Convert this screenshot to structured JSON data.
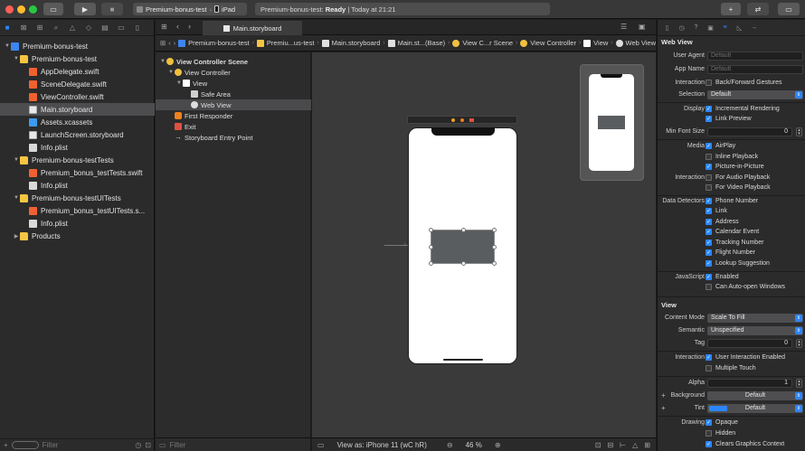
{
  "toolbar": {
    "run_icon": "play-icon",
    "stop_icon": "stop-icon",
    "scheme_name": "Premium-bonus-test",
    "device": "iPad",
    "status_project": "Premium-bonus-test:",
    "status_state": "Ready",
    "status_time": "| Today at 21:21"
  },
  "editor_tab": {
    "label": "Main.storyboard"
  },
  "navigator": {
    "items": [
      {
        "label": "Premium-bonus-test",
        "icon": "project",
        "level": 0,
        "disclosure": "down"
      },
      {
        "label": "Premium-bonus-test",
        "icon": "folder",
        "level": 1,
        "disclosure": "down"
      },
      {
        "label": "AppDelegate.swift",
        "icon": "swift",
        "level": 2
      },
      {
        "label": "SceneDelegate.swift",
        "icon": "swift",
        "level": 2
      },
      {
        "label": "ViewController.swift",
        "icon": "swift",
        "level": 2
      },
      {
        "label": "Main.storyboard",
        "icon": "storyboard",
        "level": 2,
        "selected": true
      },
      {
        "label": "Assets.xcassets",
        "icon": "assets",
        "level": 2
      },
      {
        "label": "LaunchScreen.storyboard",
        "icon": "storyboard",
        "level": 2
      },
      {
        "label": "Info.plist",
        "icon": "plist",
        "level": 2
      },
      {
        "label": "Premium-bonus-testTests",
        "icon": "folder",
        "level": 1,
        "disclosure": "down"
      },
      {
        "label": "Premium_bonus_testTests.swift",
        "icon": "swift",
        "level": 2
      },
      {
        "label": "Info.plist",
        "icon": "plist",
        "level": 2
      },
      {
        "label": "Premium-bonus-testUITests",
        "icon": "folder",
        "level": 1,
        "disclosure": "down"
      },
      {
        "label": "Premium_bonus_testUITests.s...",
        "icon": "swift",
        "level": 2
      },
      {
        "label": "Info.plist",
        "icon": "plist",
        "level": 2
      },
      {
        "label": "Products",
        "icon": "folder",
        "level": 1,
        "disclosure": "right"
      }
    ],
    "filter_placeholder": "Filter"
  },
  "jumpbar": {
    "crumbs": [
      "Premium-bonus-test",
      "Premiu...us-test",
      "Main.storyboard",
      "Main.st...(Base)",
      "View C...r Scene",
      "View Controller",
      "View",
      "Web View"
    ]
  },
  "outline": {
    "items": [
      {
        "label": "View Controller Scene",
        "level": 0,
        "disclosure": "down",
        "bold": true
      },
      {
        "label": "View Controller",
        "level": 1,
        "disclosure": "down"
      },
      {
        "label": "View",
        "level": 2,
        "disclosure": "down"
      },
      {
        "label": "Safe Area",
        "level": 3
      },
      {
        "label": "Web View",
        "level": 3,
        "selected": true
      },
      {
        "label": "First Responder",
        "level": 1
      },
      {
        "label": "Exit",
        "level": 1
      },
      {
        "label": "Storyboard Entry Point",
        "level": 1
      }
    ],
    "filter_placeholder": "Filter"
  },
  "editor_bottom": {
    "view_as": "View as: iPhone 11 (wC hR)",
    "zoom": "46 %"
  },
  "inspector": {
    "web_view_title": "Web View",
    "user_agent_label": "User Agent",
    "user_agent_placeholder": "Default",
    "app_name_label": "App Name",
    "app_name_placeholder": "Default",
    "interaction_label": "Interaction",
    "back_forward": "Back/Forward Gestures",
    "selection_label": "Selection",
    "selection_value": "Default",
    "display_label": "Display",
    "incremental": "Incremental Rendering",
    "link_preview": "Link Preview",
    "min_font_label": "Min Font Size",
    "min_font_value": "0",
    "media_label": "Media",
    "airplay": "AirPlay",
    "inline_playback": "Inline Playback",
    "pip": "Picture-in-Picture",
    "interaction2_label": "Interaction",
    "audio_playback": "For Audio Playback",
    "video_playback": "For Video Playback",
    "data_detectors_label": "Data Detectors",
    "phone": "Phone Number",
    "link": "Link",
    "address": "Address",
    "calendar": "Calendar Event",
    "tracking": "Tracking Number",
    "flight": "Flight Number",
    "lookup": "Lookup Suggestion",
    "javascript_label": "JavaScript",
    "js_enabled": "Enabled",
    "auto_open": "Can Auto-open Windows",
    "view_title": "View",
    "content_mode_label": "Content Mode",
    "content_mode_value": "Scale To Fill",
    "semantic_label": "Semantic",
    "semantic_value": "Unspecified",
    "tag_label": "Tag",
    "tag_value": "0",
    "interaction3_label": "Interaction",
    "user_interaction": "User Interaction Enabled",
    "multiple_touch": "Multiple Touch",
    "alpha_label": "Alpha",
    "alpha_value": "1",
    "background_label": "Background",
    "background_value": "Default",
    "tint_label": "Tint",
    "tint_value": "Default",
    "drawing_label": "Drawing",
    "opaque": "Opaque",
    "hidden": "Hidden",
    "clears_graphics": "Clears Graphics Context"
  },
  "colors": {
    "accent": "#2d86ff",
    "canvas": "#3a3a3a",
    "webview_placeholder": "#5a5d60"
  }
}
